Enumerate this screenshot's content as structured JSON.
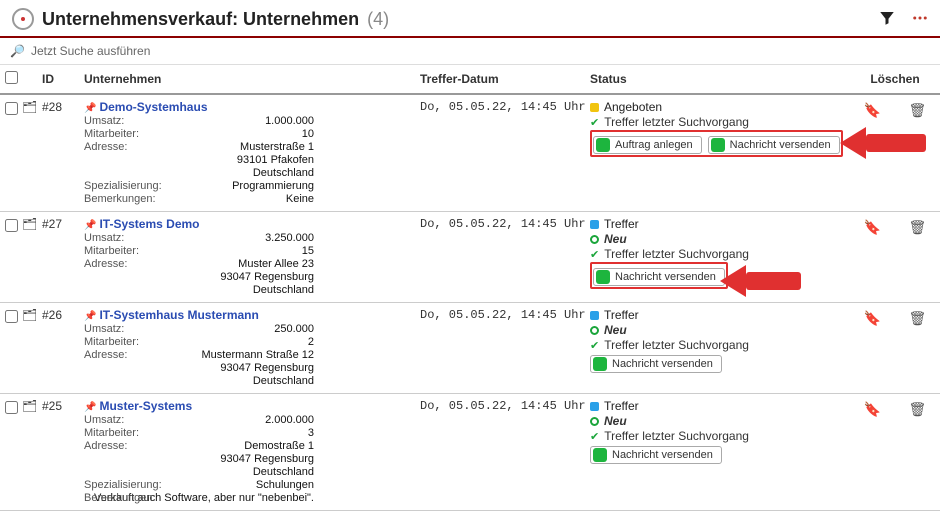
{
  "header": {
    "title": "Unternehmensverkauf: Unternehmen",
    "count": "(4)"
  },
  "search_text": "Jetzt Suche ausführen",
  "columns": {
    "id": "ID",
    "name": "Unternehmen",
    "date": "Treffer-Datum",
    "status": "Status",
    "delete": "Löschen"
  },
  "labels": {
    "umsatz": "Umsatz:",
    "mitarbeiter": "Mitarbeiter:",
    "adresse": "Adresse:",
    "spezialisierung": "Spezialisierung:",
    "bemerkungen": "Bemerkungen:"
  },
  "status": {
    "angeboten": "Angeboten",
    "treffer": "Treffer",
    "neu": "Neu",
    "last_search": "Treffer letzter Suchvorgang",
    "btn_auftrag": "Auftrag anlegen",
    "btn_nachricht": "Nachricht versenden"
  },
  "rows": [
    {
      "id": "#28",
      "name": "Demo-Systemhaus",
      "umsatz": "1.000.000",
      "mitarbeiter": "10",
      "addr1": "Musterstraße 1",
      "addr2": "93101 Pfakofen",
      "addr3": "Deutschland",
      "spezialisierung": "Programmierung",
      "bemerkungen": "Keine",
      "date": "Do, 05.05.22, 14:45 Uhr"
    },
    {
      "id": "#27",
      "name": "IT-Systems Demo",
      "umsatz": "3.250.000",
      "mitarbeiter": "15",
      "addr1": "Muster Allee 23",
      "addr2": "93047 Regensburg",
      "addr3": "Deutschland",
      "date": "Do, 05.05.22, 14:45 Uhr"
    },
    {
      "id": "#26",
      "name": "IT-Systemhaus Mustermann",
      "umsatz": "250.000",
      "mitarbeiter": "2",
      "addr1": "Mustermann Straße 12",
      "addr2": "93047 Regensburg",
      "addr3": "Deutschland",
      "date": "Do, 05.05.22, 14:45 Uhr"
    },
    {
      "id": "#25",
      "name": "Muster-Systems",
      "umsatz": "2.000.000",
      "mitarbeiter": "3",
      "addr1": "Demostraße 1",
      "addr2": "93047 Regensburg",
      "addr3": "Deutschland",
      "spezialisierung": "Schulungen",
      "bemerkungen": "Verkauft auch Software, aber nur \"nebenbei\".",
      "date": "Do, 05.05.22, 14:45 Uhr"
    }
  ]
}
